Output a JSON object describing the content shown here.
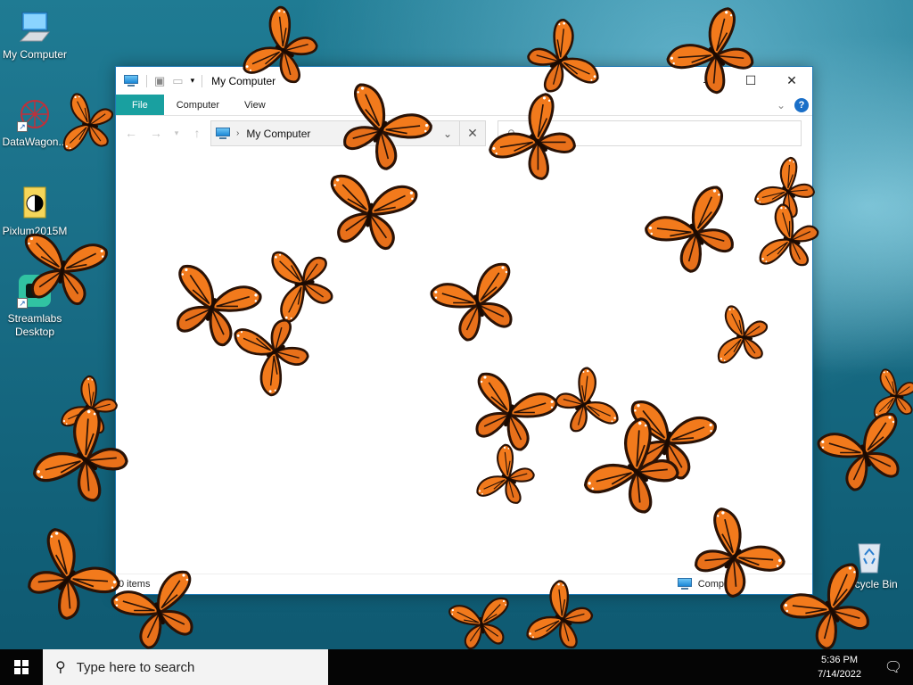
{
  "desktop": {
    "icons": [
      {
        "label": "My Computer",
        "icon": "my-computer-icon"
      },
      {
        "label": "DataWagon...",
        "icon": "datawagon-icon"
      },
      {
        "label": "Pixlum2015M",
        "icon": "pixlum-icon"
      },
      {
        "label": "Streamlabs\nDesktop",
        "icon": "streamlabs-icon"
      },
      {
        "label": "Recycle Bin",
        "icon": "recycle-bin-icon"
      }
    ]
  },
  "explorer": {
    "title": "My Computer",
    "tabs": [
      {
        "label": "File"
      },
      {
        "label": "Computer"
      },
      {
        "label": "View"
      }
    ],
    "address_path": "My Computer",
    "search_placeholder": "",
    "status_items": "0 items",
    "status_right": "Computer"
  },
  "taskbar": {
    "search_placeholder": "Type here to search",
    "time": "5:36 PM",
    "date": "7/14/2022"
  },
  "colors": {
    "file_tab": "#19a0a0",
    "butterfly_orange": "#f07a1a",
    "butterfly_dark": "#3a1a08"
  }
}
